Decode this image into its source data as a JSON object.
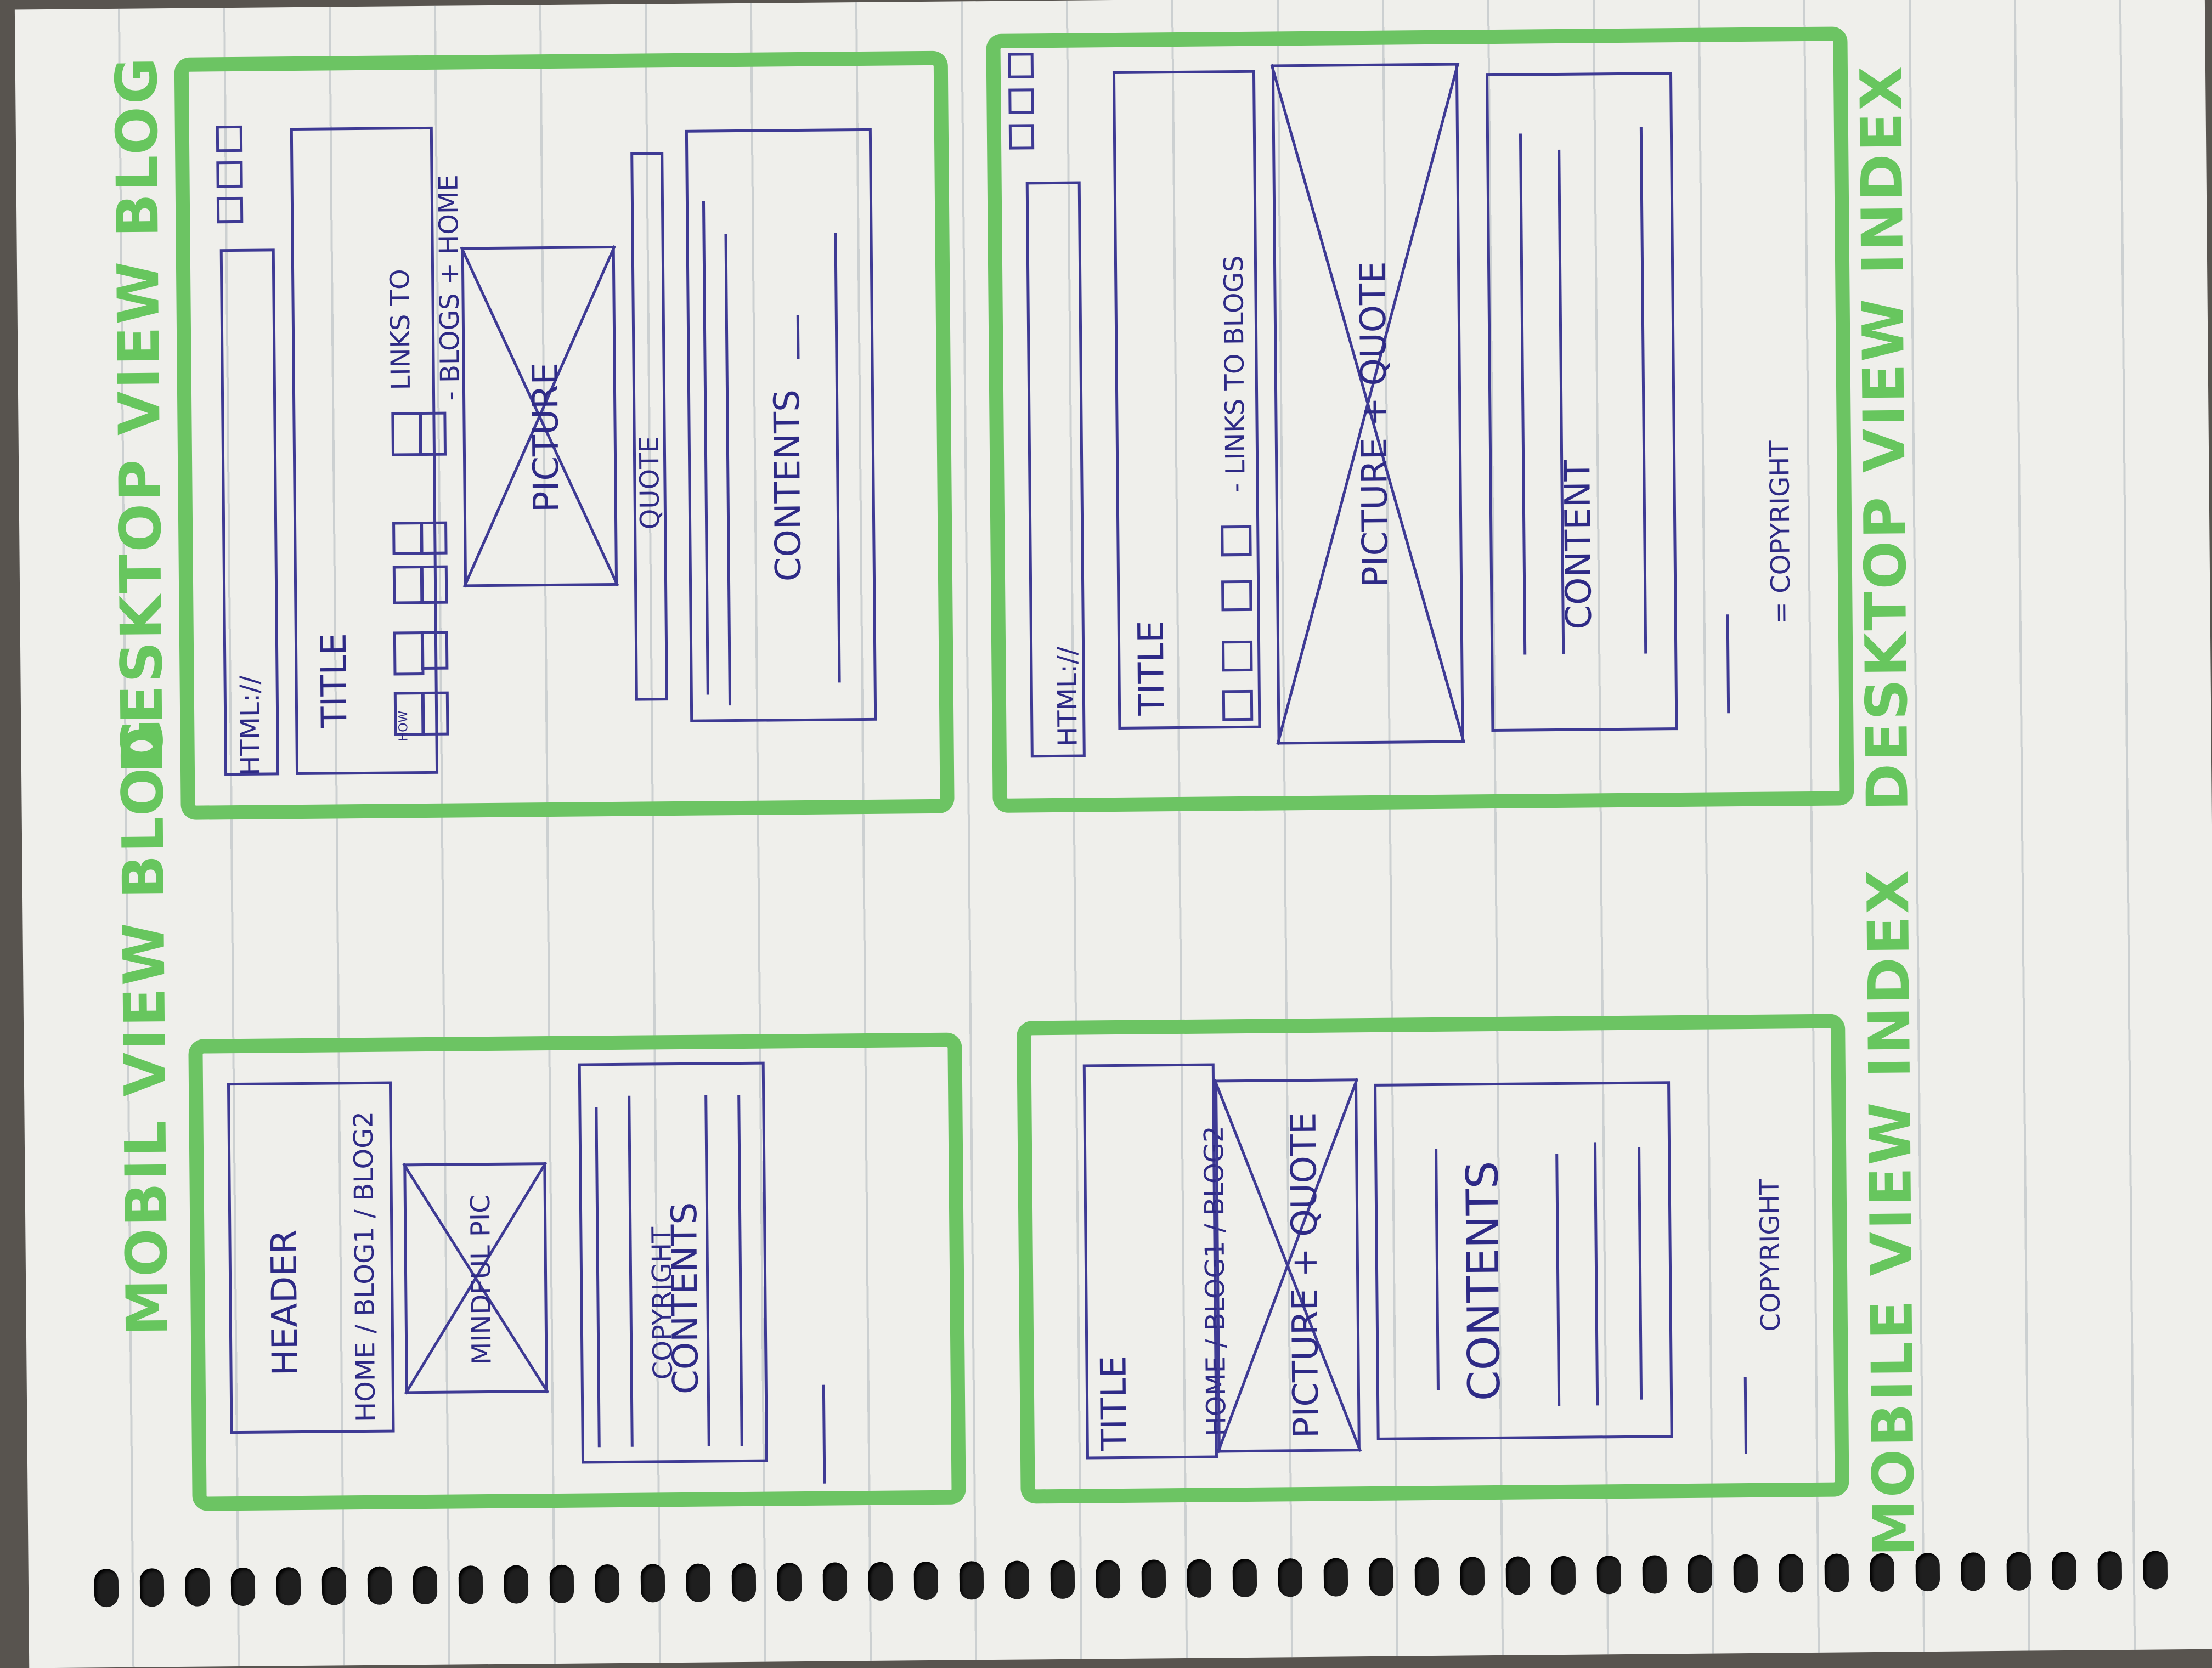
{
  "labels": {
    "mobile_blog": "MOBIL VIEW BLOG",
    "desktop_blog": "DESKTOP VIEW BLOG",
    "mobile_index": "MOBILE VIEW INDEX",
    "desktop_index": "DESKTOP VIEW INDEX"
  },
  "mobile_blog": {
    "header": "HEADER",
    "nav": "HOME / BLOG1 / BLOG2",
    "picture": "MINDFUL PIC",
    "contents": "CONTENTS",
    "copyright": "COPYRIGHT"
  },
  "desktop_blog": {
    "url": "HTML://",
    "title": "TITLE",
    "nav_tag": "HOW",
    "links": "LINKS TO",
    "links2": "- BLOGS + HOME",
    "picture": "PICTURE",
    "quote": "QUOTE",
    "contents": "CONTENTS"
  },
  "mobile_index": {
    "title": "TITLE",
    "nav": "HOME / BLOG1 / BLOG2",
    "picture": "PICTURE + QUOTE",
    "contents": "CONTENTS",
    "copyright": "COPYRIGHT"
  },
  "desktop_index": {
    "url": "HTML://",
    "title": "TITLE",
    "links": "- LINKS TO BLOGS",
    "picture": "PICTURE + QUOTE",
    "content": "CONTENT",
    "copyright": "= COPYRIGHT"
  },
  "colors": {
    "marker_green": "#6cc463",
    "pen_blue": "#3e3a94",
    "paper": "#efefeb"
  }
}
